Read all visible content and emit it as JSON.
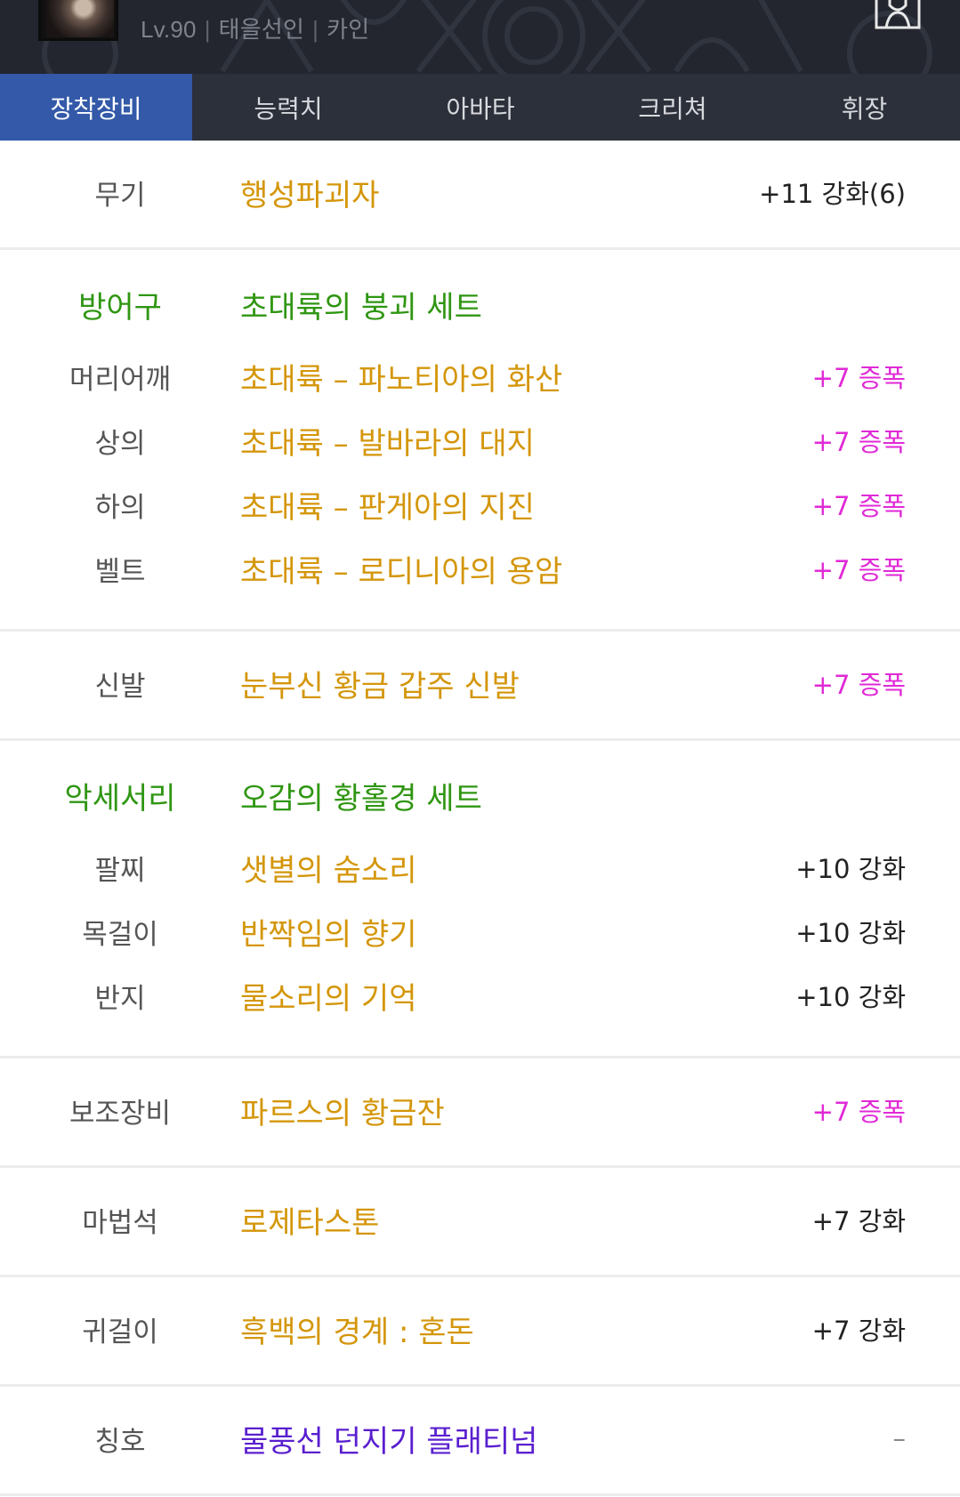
{
  "header": {
    "level": "Lv.90",
    "job": "태을선인",
    "name": "카인"
  },
  "tabs": [
    {
      "label": "장착장비",
      "active": true
    },
    {
      "label": "능력치",
      "active": false
    },
    {
      "label": "아바타",
      "active": false
    },
    {
      "label": "크리쳐",
      "active": false
    },
    {
      "label": "휘장",
      "active": false
    }
  ],
  "equipment": {
    "weapon": {
      "slot": "무기",
      "name": "행성파괴자",
      "enhance": "+11 강화(6)"
    },
    "armor": {
      "slot": "방어구",
      "set_name": "초대륙의 붕괴 세트",
      "items": [
        {
          "slot": "머리어깨",
          "name": "초대륙 – 파노티아의 화산",
          "enhance": "+7 증폭"
        },
        {
          "slot": "상의",
          "name": "초대륙 – 발바라의 대지",
          "enhance": "+7 증폭"
        },
        {
          "slot": "하의",
          "name": "초대륙 – 판게아의 지진",
          "enhance": "+7 증폭"
        },
        {
          "slot": "벨트",
          "name": "초대륙 – 로디니아의 용암",
          "enhance": "+7 증폭"
        }
      ]
    },
    "shoes": {
      "slot": "신발",
      "name": "눈부신 황금 갑주 신발",
      "enhance": "+7 증폭"
    },
    "accessory": {
      "slot": "악세서리",
      "set_name": "오감의 황홀경 세트",
      "items": [
        {
          "slot": "팔찌",
          "name": "샛별의 숨소리",
          "enhance": "+10 강화"
        },
        {
          "slot": "목걸이",
          "name": "반짝임의 향기",
          "enhance": "+10 강화"
        },
        {
          "slot": "반지",
          "name": "물소리의 기억",
          "enhance": "+10 강화"
        }
      ]
    },
    "sub": {
      "slot": "보조장비",
      "name": "파르스의 황금잔",
      "enhance": "+7 증폭"
    },
    "magicstone": {
      "slot": "마법석",
      "name": "로제타스톤",
      "enhance": "+7 강화"
    },
    "earring": {
      "slot": "귀걸이",
      "name": "흑백의 경계 : 혼돈",
      "enhance": "+7 강화"
    },
    "title": {
      "slot": "칭호",
      "name": "물풍선 던지기 플래티넘",
      "enhance": "–"
    }
  },
  "colors": {
    "header_bg": "#23262f",
    "tab_bg": "#2c303a",
    "tab_active": "#3359a8",
    "item_gold": "#d4960a",
    "set_green": "#2f9612",
    "amplify_pink": "#e02ad6",
    "title_purple": "#5a1fcf"
  }
}
